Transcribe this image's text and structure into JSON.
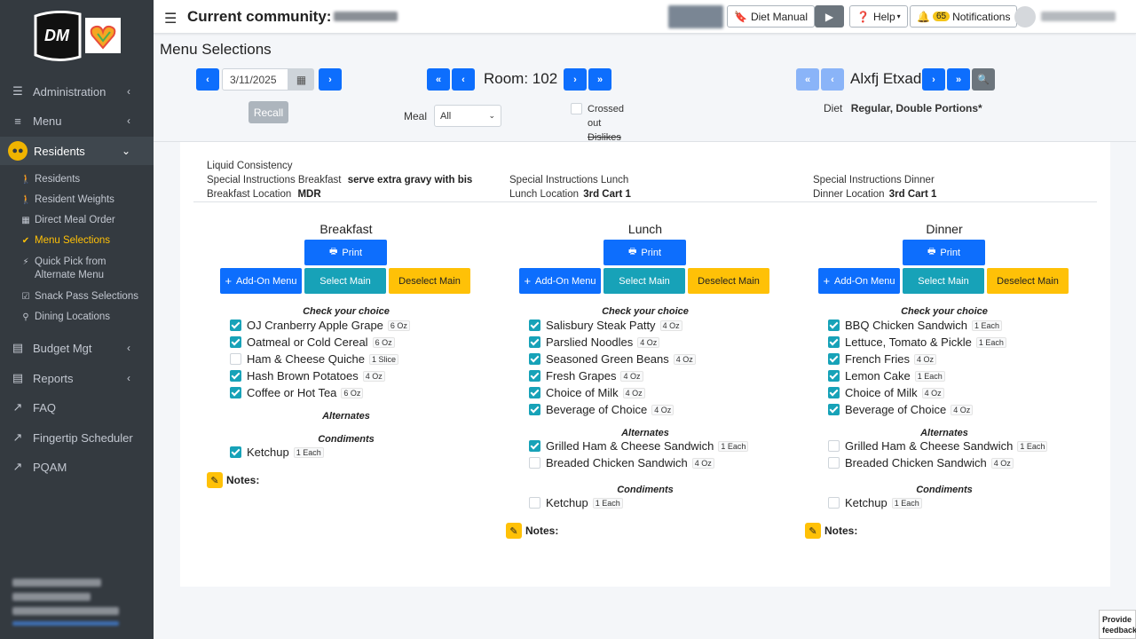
{
  "sidebar": {
    "logo_text": "DM",
    "main_items": [
      {
        "label": "Administration",
        "icon": "sliders-icon"
      },
      {
        "label": "Menu",
        "icon": "list-icon"
      },
      {
        "label": "Residents",
        "icon": "users-icon"
      },
      {
        "label": "Budget Mgt",
        "icon": "ledger-icon"
      },
      {
        "label": "Reports",
        "icon": "report-icon"
      },
      {
        "label": "FAQ",
        "icon": "external-link-icon"
      },
      {
        "label": "Fingertip Scheduler",
        "icon": "external-link-icon"
      },
      {
        "label": "PQAM",
        "icon": "external-link-icon"
      }
    ],
    "sub_items": [
      {
        "label": "Residents"
      },
      {
        "label": "Resident Weights"
      },
      {
        "label": "Direct Meal Order"
      },
      {
        "label": "Menu Selections"
      },
      {
        "label": "Quick Pick from Alternate Menu"
      },
      {
        "label": "Snack Pass Selections"
      },
      {
        "label": "Dining Locations"
      }
    ]
  },
  "header": {
    "community_label": "Current community:",
    "diet_manual": "Diet Manual",
    "help": "Help",
    "notif_count": "65",
    "notifications": "Notifications"
  },
  "page": {
    "title": "Menu Selections",
    "date": "3/11/2025",
    "room": "Room: 102",
    "resident": "Alxfj Etxad",
    "recall": "Recall",
    "meal_label": "Meal",
    "meal_value": "All",
    "crossed_label_1": "Crossed",
    "crossed_label_2": "out",
    "crossed_label_3": "Dislikes",
    "diet_label": "Diet",
    "diet_value": "Regular, Double Portions*"
  },
  "info": {
    "liquid": "Liquid Consistency",
    "si_breakfast_label": "Special Instructions Breakfast",
    "si_breakfast_value": "serve extra gravy with bis",
    "bl_label": "Breakfast Location",
    "bl_value": "MDR",
    "si_lunch_label": "Special Instructions Lunch",
    "ll_label": "Lunch Location",
    "ll_value": "3rd Cart 1",
    "si_dinner_label": "Special Instructions Dinner",
    "dl_label": "Dinner Location",
    "dl_value": "3rd Cart 1"
  },
  "buttons": {
    "print": "Print",
    "add_on": "Add-On Menu",
    "select_main": "Select Main",
    "deselect_main": "Deselect Main"
  },
  "sections": {
    "choice": "Check your choice",
    "alternates": "Alternates",
    "condiments": "Condiments",
    "notes": "Notes:"
  },
  "meals": [
    {
      "title": "Breakfast",
      "items": [
        {
          "name": "OJ Cranberry Apple Grape",
          "qty": "6 Oz",
          "checked": true
        },
        {
          "name": "Oatmeal or Cold Cereal",
          "qty": "6 Oz",
          "checked": true
        },
        {
          "name": "Ham & Cheese Quiche",
          "qty": "1 Slice",
          "checked": false
        },
        {
          "name": "Hash Brown Potatoes",
          "qty": "4 Oz",
          "checked": true
        },
        {
          "name": "Coffee or Hot Tea",
          "qty": "6 Oz",
          "checked": true
        }
      ],
      "alternates": [],
      "condiments": [
        {
          "name": "Ketchup",
          "qty": "1 Each",
          "checked": true
        }
      ]
    },
    {
      "title": "Lunch",
      "items": [
        {
          "name": "Salisbury Steak Patty",
          "qty": "4 Oz",
          "checked": true
        },
        {
          "name": "Parslied Noodles",
          "qty": "4 Oz",
          "checked": true
        },
        {
          "name": "Seasoned Green Beans",
          "qty": "4 Oz",
          "checked": true
        },
        {
          "name": "Fresh Grapes",
          "qty": "4 Oz",
          "checked": true
        },
        {
          "name": "Choice of Milk",
          "qty": "4 Oz",
          "checked": true
        },
        {
          "name": "Beverage of Choice",
          "qty": "4 Oz",
          "checked": true
        }
      ],
      "alternates": [
        {
          "name": "Grilled Ham & Cheese Sandwich",
          "qty": "1 Each",
          "checked": true
        },
        {
          "name": "Breaded Chicken Sandwich",
          "qty": "4 Oz",
          "checked": false
        }
      ],
      "condiments": [
        {
          "name": "Ketchup",
          "qty": "1 Each",
          "checked": false
        }
      ]
    },
    {
      "title": "Dinner",
      "items": [
        {
          "name": "BBQ Chicken Sandwich",
          "qty": "1 Each",
          "checked": true
        },
        {
          "name": "Lettuce, Tomato & Pickle",
          "qty": "1 Each",
          "checked": true
        },
        {
          "name": "French Fries",
          "qty": "4 Oz",
          "checked": true
        },
        {
          "name": "Lemon Cake",
          "qty": "1 Each",
          "checked": true
        },
        {
          "name": "Choice of Milk",
          "qty": "4 Oz",
          "checked": true
        },
        {
          "name": "Beverage of Choice",
          "qty": "4 Oz",
          "checked": true
        }
      ],
      "alternates": [
        {
          "name": "Grilled Ham & Cheese Sandwich",
          "qty": "1 Each",
          "checked": false
        },
        {
          "name": "Breaded Chicken Sandwich",
          "qty": "4 Oz",
          "checked": false
        }
      ],
      "condiments": [
        {
          "name": "Ketchup",
          "qty": "1 Each",
          "checked": false
        }
      ]
    }
  ],
  "feedback": {
    "line1": "Provide",
    "line2": "feedback"
  },
  "colors": {
    "sidebar": "#343a40",
    "primary": "#0d6efd",
    "teal": "#17a2b8",
    "warning": "#ffc107"
  }
}
